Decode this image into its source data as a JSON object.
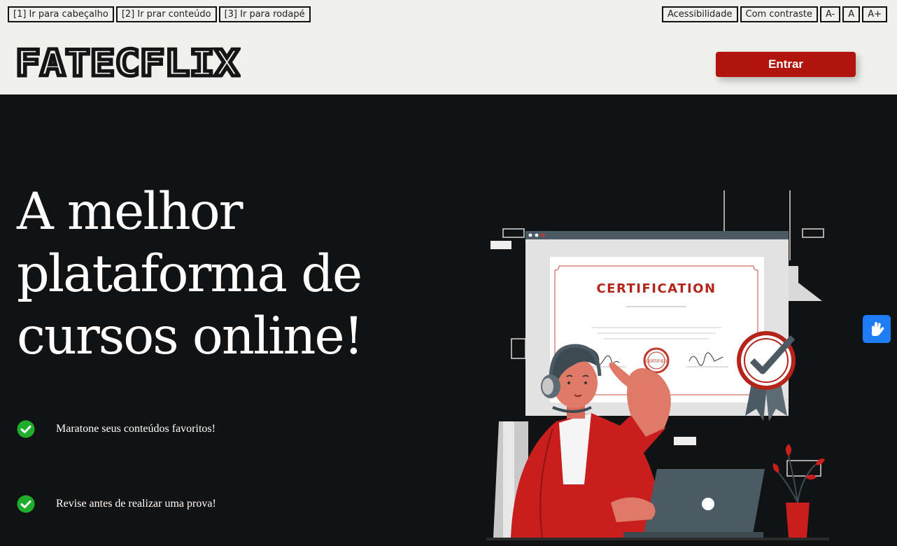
{
  "skip_links": [
    "[1] Ir para cabeçalho",
    "[2] Ir prar conteúdo",
    "[3] Ir para rodapé"
  ],
  "accessibility": {
    "label": "Acessibilidade",
    "contrast": "Com contraste",
    "font_decrease": "A-",
    "font_normal": "A",
    "font_increase": "A+"
  },
  "brand": {
    "logo_text": "FATECFLIX"
  },
  "header": {
    "login_label": "Entrar"
  },
  "hero": {
    "title_lines": [
      "A melhor",
      "plataforma de",
      "cursos online!"
    ],
    "features": [
      "Maratone seus conteúdos favoritos!",
      "Revise antes de realizar uma prova!"
    ]
  },
  "illustration": {
    "certificate_title": "CERTIFICATION",
    "stamp_text": "CERTIFIED"
  },
  "colors": {
    "header_bg": "#f0f0ec",
    "page_bg": "#111214",
    "accent_red": "#b1140d",
    "check_green": "#1fae2b",
    "vlibras_blue": "#1e7cf4"
  },
  "icons": {
    "feature_icon": "check-circle-icon",
    "widget_icon": "sign-language-icon"
  }
}
